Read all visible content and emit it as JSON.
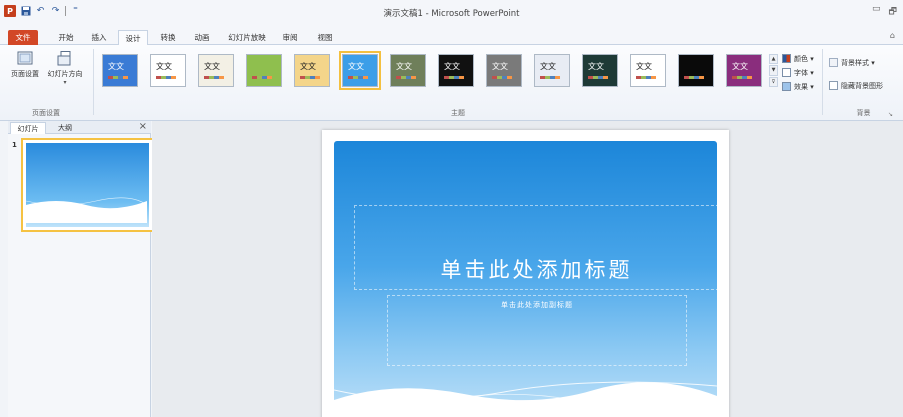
{
  "window": {
    "title": "演示文稿1 - Microsoft PowerPoint",
    "controls": [
      "▭",
      "🗗"
    ]
  },
  "qat": {
    "logo": "P",
    "undo": "↶",
    "redo": "↷",
    "custom": "⁼"
  },
  "tabs": [
    {
      "label": "文件"
    },
    {
      "label": "开始"
    },
    {
      "label": "插入"
    },
    {
      "label": "设计"
    },
    {
      "label": "转换"
    },
    {
      "label": "动画"
    },
    {
      "label": "幻灯片放映"
    },
    {
      "label": "审阅"
    },
    {
      "label": "视图"
    }
  ],
  "active_tab": "设计",
  "page_setup": {
    "page_setup_label": "页面设置",
    "orientation_label": "幻灯片方向",
    "group_label": "页面设置"
  },
  "themes": {
    "group_label": "主题",
    "items": [
      {
        "text": "文文",
        "bg": "#3a7bd5"
      },
      {
        "text": "文文",
        "bg": "#ffffff"
      },
      {
        "text": "文文",
        "bg": "#f3f0e5"
      },
      {
        "text": "",
        "bg": "#8fbf4e"
      },
      {
        "text": "文文",
        "bg": "#f4d58a"
      },
      {
        "text": "文文",
        "bg": "#3c9ee8"
      },
      {
        "text": "文文",
        "bg": "#6f7f5a"
      },
      {
        "text": "文文",
        "bg": "#111111"
      },
      {
        "text": "文文",
        "bg": "#7a7a7a"
      },
      {
        "text": "文文",
        "bg": "#e8ecf4"
      },
      {
        "text": "文文",
        "bg": "#1e3a36"
      },
      {
        "text": "文文",
        "bg": "#ffffff"
      },
      {
        "text": "",
        "bg": "#0a0a0a"
      },
      {
        "text": "文文",
        "bg": "#8a2d7d"
      }
    ],
    "colors_label": "颜色 ▾",
    "fonts_label": "字体 ▾",
    "effects_label": "效果 ▾"
  },
  "background": {
    "styles_label": "背景样式 ▾",
    "hide_graphics_label": "隐藏背景图形",
    "group_label": "背景"
  },
  "panel": {
    "tab_slides": "幻灯片",
    "tab_outline": "大纲",
    "close": "×",
    "slide_number": "1"
  },
  "slide": {
    "title_placeholder": "单击此处添加标题",
    "subtitle_placeholder": "单击此处添加副标题"
  },
  "colors": {
    "accent": "#d24726",
    "ribbon_bg": "#fbfcfe",
    "slide_blue": "#1c86d9",
    "selection": "#f4c03f"
  }
}
